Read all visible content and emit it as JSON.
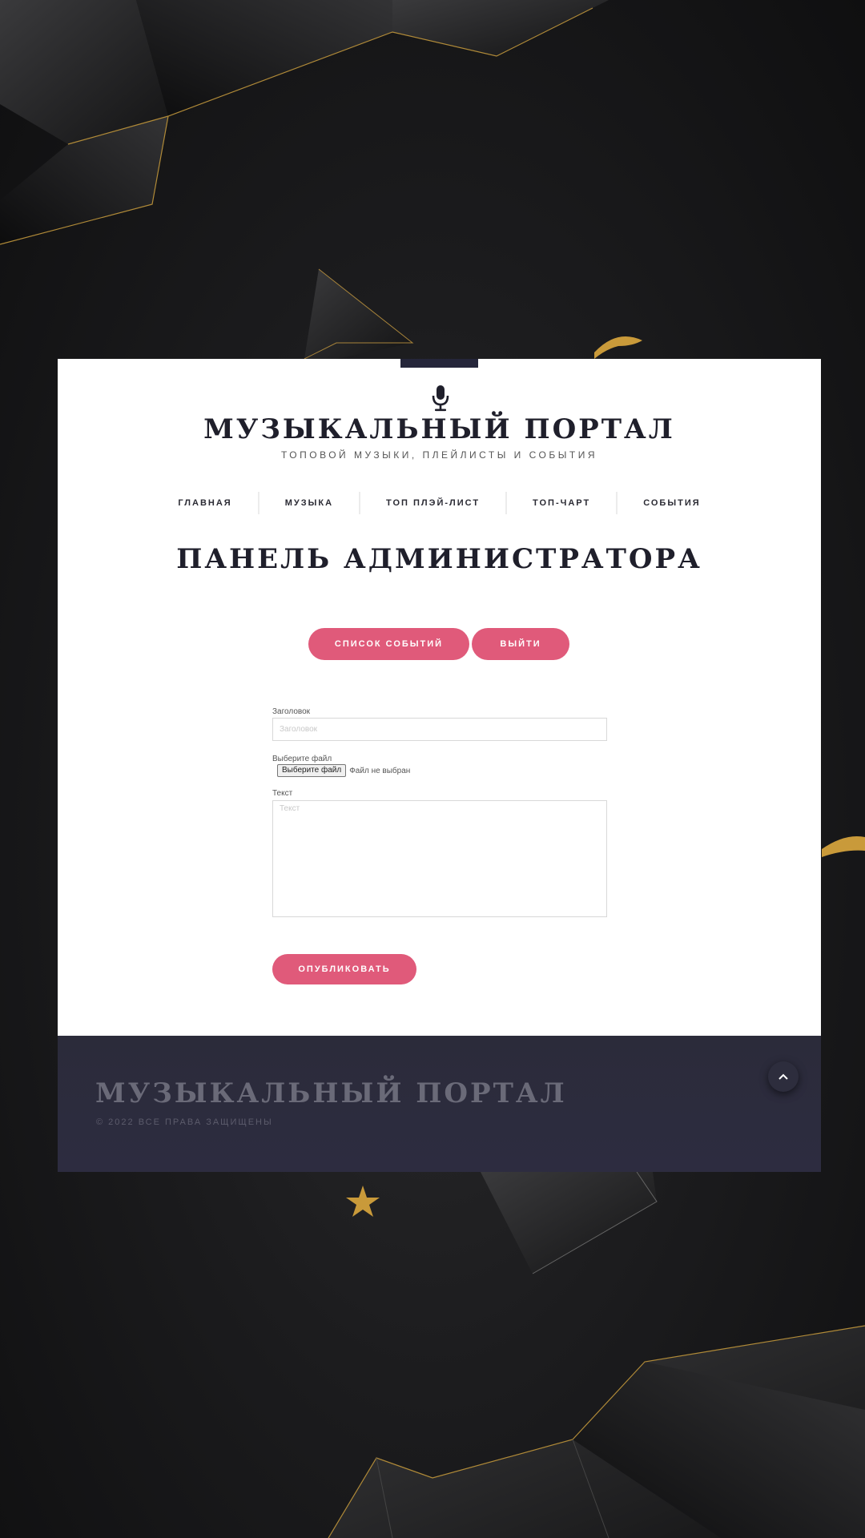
{
  "header": {
    "icon": "microphone-icon",
    "site_title": "МУЗЫКАЛЬНЫЙ ПОРТАЛ",
    "site_subtitle": "ТОПОВОЙ МУЗЫКИ, ПЛЕЙЛИСТЫ И СОБЫТИЯ"
  },
  "nav": {
    "items": [
      {
        "label": "ГЛАВНАЯ"
      },
      {
        "label": "МУЗЫКА"
      },
      {
        "label": "ТОП ПЛЭЙ-ЛИСТ"
      },
      {
        "label": "ТОП-ЧАРТ"
      },
      {
        "label": "СОБЫТИЯ"
      }
    ]
  },
  "main": {
    "page_title": "ПАНЕЛЬ АДМИНИСТРАТОРА",
    "events_button": "СПИСОК СОБЫТИЙ",
    "logout_button": "ВЫЙТИ"
  },
  "form": {
    "title_label": "Заголовок",
    "title_placeholder": "Заголовок",
    "title_value": "",
    "file_label": "Выберите файл",
    "file_button": "Выберите файл",
    "file_status": "Файл не выбран",
    "text_label": "Текст",
    "text_placeholder": "Текст",
    "text_value": "",
    "publish_button": "ОПУБЛИКОВАТЬ"
  },
  "footer": {
    "title": "МУЗЫКАЛЬНЫЙ ПОРТАЛ",
    "copyright": "© 2022 ВСЕ ПРАВА ЗАЩИЩЕНЫ",
    "scroll_top_icon": "chevron-up-icon"
  },
  "colors": {
    "accent": "#e05a7a",
    "dark": "#25263a",
    "footer_bg": "#2b2b3a",
    "gold": "#d9a441"
  }
}
